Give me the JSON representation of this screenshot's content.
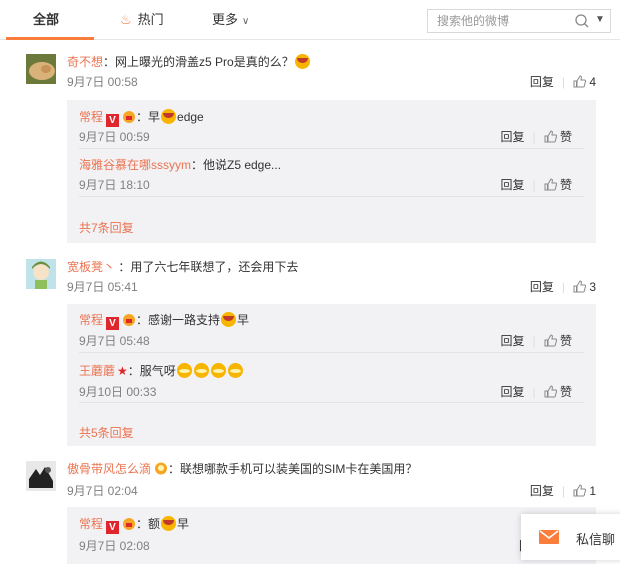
{
  "tabs": {
    "all": "全部",
    "hot": "热门",
    "more": "更多"
  },
  "search": {
    "placeholder": "搜索他的微博"
  },
  "comments": [
    {
      "user": "奇不想",
      "text": "：网上曝光的滑盖z5 Pro是真的么？",
      "time": "9月7日 00:58",
      "reply_label": "回复",
      "likes": "4",
      "replies": [
        {
          "user": "常程",
          "text": "：早",
          "text2": "edge",
          "time": "9月7日 00:59",
          "reply_label": "回复",
          "like_label": "赞"
        },
        {
          "user": "海雅谷慕在哪sssyym",
          "text": "：他说Z5 edge...",
          "time": "9月7日 18:10",
          "reply_label": "回复",
          "like_label": "赞"
        }
      ],
      "more_replies": "共7条回复"
    },
    {
      "user": "宽板凳丶",
      "text": " ：用了六七年联想了，还会用下去",
      "time": "9月7日 05:41",
      "reply_label": "回复",
      "likes": "3",
      "replies": [
        {
          "user": "常程",
          "text": "：感谢一路支持",
          "text2": "早",
          "time": "9月7日 05:48",
          "reply_label": "回复",
          "like_label": "赞"
        },
        {
          "user": "王蘑蘑",
          "text": "：服气呀",
          "time": "9月10日 00:33",
          "reply_label": "回复",
          "like_label": "赞"
        }
      ],
      "more_replies": "共5条回复"
    },
    {
      "user": "傲骨带风怎么滴",
      "text": "：联想哪款手机可以装美国的SIM卡在美国用？",
      "time": "9月7日 02:04",
      "reply_label": "回复",
      "likes": "1",
      "replies": [
        {
          "user": "常程",
          "text": "：额",
          "text2": "早",
          "time": "9月7日 02:08",
          "reply_label": "回"
        }
      ]
    }
  ],
  "message_panel": {
    "label": "私信聊"
  },
  "colors": {
    "accent": "#fa7d3c",
    "username": "#eb7350",
    "sub_bg": "#f2f2f5",
    "verified": "#e0262d"
  }
}
